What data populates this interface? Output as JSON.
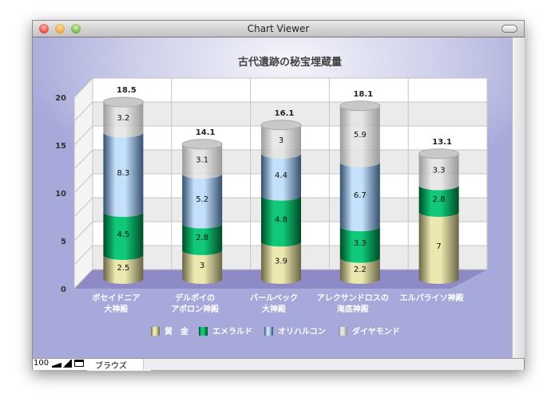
{
  "window": {
    "title": "Chart Viewer"
  },
  "status": {
    "zoom": "100",
    "mode": "ブラウズ"
  },
  "colors": {
    "gold": [
      "#ece8b0",
      "#6a6646"
    ],
    "emerald": [
      "#10c878",
      "#004a26"
    ],
    "orichalcum": [
      "#c4e0fa",
      "#34506e"
    ],
    "diamond": [
      "#e4e4e4",
      "#8c8c8c"
    ]
  },
  "chart_data": {
    "type": "bar",
    "subtype": "stacked-3d-cylinder",
    "title": "古代遺跡の秘宝埋蔵量",
    "categories": [
      [
        "ポセイドニア",
        "大神殿"
      ],
      [
        "デルポイの",
        "アポロン神殿"
      ],
      [
        "バールベック",
        "大神殿"
      ],
      [
        "アレクサンドロスの",
        "海底神殿"
      ],
      [
        "エルパライソ神殿",
        ""
      ]
    ],
    "series": [
      {
        "name": "黄　金",
        "key": "gold",
        "values": [
          2.5,
          3,
          3.9,
          2.2,
          7
        ]
      },
      {
        "name": "エメラルド",
        "key": "emerald",
        "values": [
          4.5,
          2.8,
          4.8,
          3.3,
          2.8
        ]
      },
      {
        "name": "オリハルコン",
        "key": "orichalcum",
        "values": [
          8.3,
          5.2,
          4.4,
          6.7,
          0
        ]
      },
      {
        "name": "ダイヤモンド",
        "key": "diamond",
        "values": [
          3.2,
          3.1,
          3,
          5.9,
          3.3
        ]
      }
    ],
    "totals": [
      "18.5",
      "14.1",
      "16.1",
      "18.1",
      "13.1"
    ],
    "yticks": [
      "0",
      "5",
      "10",
      "15",
      "20"
    ],
    "ylim": [
      0,
      20
    ],
    "grid": true,
    "legend": "bottom"
  }
}
